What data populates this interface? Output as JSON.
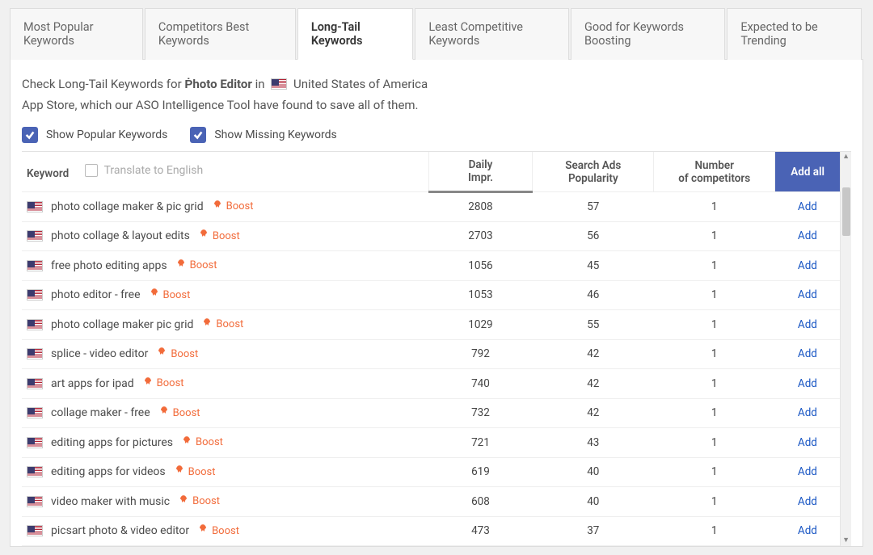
{
  "tabs": [
    {
      "label": "Most Popular Keywords",
      "active": false
    },
    {
      "label": "Competitors Best Keywords",
      "active": false
    },
    {
      "label": "Long-Tail Keywords",
      "active": true
    },
    {
      "label": "Least Competitive Keywords",
      "active": false
    },
    {
      "label": "Good for Keywords Boosting",
      "active": false
    },
    {
      "label": "Expected to be Trending",
      "active": false
    }
  ],
  "desc": {
    "line_pre": "Check Long-Tail Keywords for ",
    "app_name": "Ṗhoto Editor",
    "mid": " in ",
    "country": "United States of America",
    "line2": "App Store, which our ASO Intelligence Tool have found to save all of them."
  },
  "toggles": {
    "popular": "Show Popular Keywords",
    "missing": "Show Missing Keywords"
  },
  "columns": {
    "keyword": "Keyword",
    "translate": "Translate to English",
    "daily": "Daily Impr.",
    "sap": "Search Ads Popularity",
    "noc": "Number of competitors",
    "addall": "Add all"
  },
  "boost_label": "Boost",
  "add_label": "Add",
  "rows": [
    {
      "kw": "photo collage maker & pic grid",
      "daily": "2808",
      "sap": "57",
      "noc": "1"
    },
    {
      "kw": "photo collage & layout edits",
      "daily": "2703",
      "sap": "56",
      "noc": "1"
    },
    {
      "kw": "free photo editing apps",
      "daily": "1056",
      "sap": "45",
      "noc": "1"
    },
    {
      "kw": "photo editor - free",
      "daily": "1053",
      "sap": "46",
      "noc": "1"
    },
    {
      "kw": "photo collage maker pic grid",
      "daily": "1029",
      "sap": "55",
      "noc": "1"
    },
    {
      "kw": "splice - video editor",
      "daily": "792",
      "sap": "42",
      "noc": "1"
    },
    {
      "kw": "art apps for ipad",
      "daily": "740",
      "sap": "42",
      "noc": "1"
    },
    {
      "kw": "collage maker - free",
      "daily": "732",
      "sap": "42",
      "noc": "1"
    },
    {
      "kw": "editing apps for pictures",
      "daily": "721",
      "sap": "43",
      "noc": "1"
    },
    {
      "kw": "editing apps for videos",
      "daily": "619",
      "sap": "40",
      "noc": "1"
    },
    {
      "kw": "video maker with music",
      "daily": "608",
      "sap": "40",
      "noc": "1"
    },
    {
      "kw": "picsart photo & video editor",
      "daily": "473",
      "sap": "37",
      "noc": "1"
    }
  ]
}
